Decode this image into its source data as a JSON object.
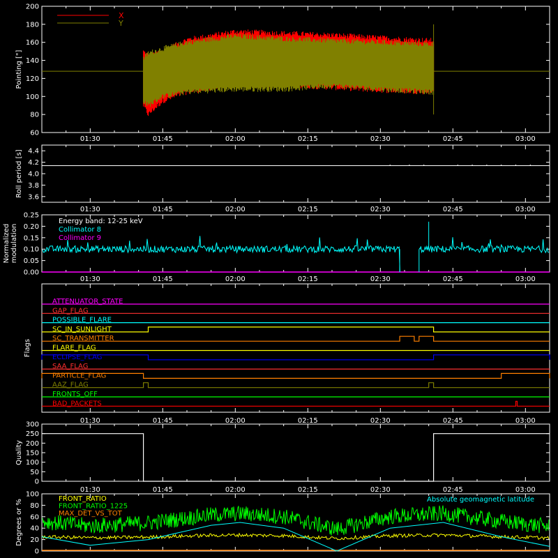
{
  "colors": {
    "background": "#000000",
    "axes": "#ffffff",
    "x_series": "#ff0000",
    "y_series": "#808000",
    "roll": "#ffffff",
    "collimator8": "#00ffff",
    "collimator9": "#ff00ff",
    "quality": "#ffffff",
    "front_ratio": "#ffff00",
    "front_ratio_1225": "#00ff00",
    "max_det_vs_tot": "#ff8000",
    "geomag_lat": "#00ffff"
  },
  "time_axis": {
    "range": [
      "01:20",
      "03:05"
    ],
    "ticks": [
      "01:30",
      "01:45",
      "02:00",
      "02:15",
      "02:30",
      "02:45",
      "03:00"
    ]
  },
  "chart_data": [
    {
      "type": "line",
      "ylabel": "Pointing [\"]",
      "ylim": [
        60,
        200
      ],
      "yticks": [
        60,
        80,
        100,
        120,
        140,
        160,
        180,
        200
      ],
      "legend": [
        {
          "name": "X",
          "color": "#ff0000"
        },
        {
          "name": "Y",
          "color": "#808000"
        }
      ],
      "constant_level": 128,
      "data_window": [
        "01:41",
        "02:41"
      ],
      "series": [
        {
          "name": "X",
          "envelope_time": [
            "01:41",
            "01:42",
            "01:45",
            "01:50",
            "02:00",
            "02:10",
            "02:20",
            "02:30",
            "02:40"
          ],
          "upper": [
            150,
            145,
            150,
            163,
            172,
            170,
            168,
            165,
            162
          ],
          "lower": [
            90,
            80,
            95,
            105,
            113,
            113,
            110,
            107,
            105
          ]
        },
        {
          "name": "Y",
          "envelope_time": [
            "01:41",
            "01:42",
            "01:45",
            "01:50",
            "02:00",
            "02:10",
            "02:20",
            "02:30",
            "02:40"
          ],
          "upper": [
            142,
            148,
            153,
            160,
            167,
            164,
            162,
            160,
            158
          ],
          "lower": [
            95,
            90,
            100,
            105,
            108,
            108,
            112,
            108,
            105
          ]
        }
      ]
    },
    {
      "type": "line",
      "ylabel": "Roll period [s]",
      "ylim": [
        3.5,
        4.5
      ],
      "yticks": [
        3.6,
        3.8,
        4.0,
        4.2,
        4.4
      ],
      "series": [
        {
          "name": "",
          "x": [
            "01:20",
            "03:05"
          ],
          "y": [
            4.14,
            4.14
          ]
        }
      ]
    },
    {
      "type": "line",
      "ylabel": "Normalized modulation",
      "ylim": [
        0.0,
        0.25
      ],
      "yticks": [
        0.0,
        0.05,
        0.1,
        0.15,
        0.2,
        0.25
      ],
      "annotation": "Energy band: 12-25 keV",
      "legend": [
        {
          "name": "Collimator 8",
          "color": "#00ffff"
        },
        {
          "name": "Collimator 9",
          "color": "#ff00ff"
        }
      ],
      "series": [
        {
          "name": "Collimator 8",
          "mean": 0.1,
          "gap": [
            "02:34",
            "02:38"
          ]
        },
        {
          "name": "Collimator 9",
          "x": [
            "01:20",
            "03:05"
          ],
          "y": [
            0.0,
            0.0
          ]
        }
      ]
    },
    {
      "type": "line",
      "ylabel": "Flags",
      "flags": [
        {
          "name": "ATTENUATOR_STATE",
          "color": "#ff00ff",
          "high": []
        },
        {
          "name": "GAP_FLAG",
          "color": "#ff3030",
          "high": []
        },
        {
          "name": "POSSIBLE_FLARE",
          "color": "#00ffff",
          "high": []
        },
        {
          "name": "SC_IN_SUNLIGHT",
          "color": "#ffff00",
          "high": [
            [
              "01:42",
              "02:41"
            ]
          ]
        },
        {
          "name": "SC_TRANSMITTER",
          "color": "#ff8000",
          "high": [
            [
              "02:34",
              "02:37"
            ],
            [
              "02:38",
              "02:41"
            ]
          ]
        },
        {
          "name": "FLARE_FLAG",
          "color": "#ffff00",
          "high": []
        },
        {
          "name": "ECLIPSE_FLAG",
          "color": "#0000ff",
          "high": [
            [
              "01:20",
              "01:42"
            ],
            [
              "02:41",
              "03:05"
            ]
          ]
        },
        {
          "name": "SAA_FLAG",
          "color": "#ff3030",
          "high": []
        },
        {
          "name": "PARTICLE_FLAG",
          "color": "#ff8000",
          "high": [
            [
              "01:20",
              "01:41"
            ],
            [
              "02:55",
              "03:05"
            ]
          ]
        },
        {
          "name": "AAZ_FLAG",
          "color": "#808000",
          "high": [
            [
              "01:41",
              "01:42"
            ],
            [
              "02:40",
              "02:41"
            ]
          ]
        },
        {
          "name": "FRONTS_OFF",
          "color": "#00ff00",
          "high": []
        },
        {
          "name": "BAD_PACKETS",
          "color": "#ff0000",
          "high": [
            [
              "02:58",
              "02:58"
            ]
          ]
        }
      ]
    },
    {
      "type": "line",
      "ylabel": "Quality",
      "ylim": [
        0,
        300
      ],
      "yticks": [
        0,
        50,
        100,
        150,
        200,
        250,
        300
      ],
      "series": [
        {
          "name": "",
          "x": [
            "01:20",
            "01:41",
            "01:41",
            "02:41",
            "02:41",
            "03:05"
          ],
          "y": [
            250,
            250,
            0,
            0,
            250,
            250
          ]
        }
      ]
    },
    {
      "type": "line",
      "ylabel": "Degrees or %",
      "ylim": [
        0,
        100
      ],
      "yticks": [
        0,
        20,
        40,
        60,
        80,
        100
      ],
      "legend": [
        {
          "name": "FRONT_RATIO",
          "color": "#ffff00"
        },
        {
          "name": "FRONT_RATIO_1225",
          "color": "#00ff00"
        },
        {
          "name": "MAX_DET_VS_TOT",
          "color": "#ff8000"
        },
        {
          "name": "Absolute geomagnetic latitude",
          "color": "#00ffff"
        }
      ],
      "series": [
        {
          "name": "FRONT_RATIO",
          "mean": 25
        },
        {
          "name": "FRONT_RATIO_1225",
          "mean": 52
        },
        {
          "name": "MAX_DET_VS_TOT",
          "x": [
            "01:20",
            "03:05"
          ],
          "y": [
            0,
            0
          ]
        },
        {
          "name": "Absolute geomagnetic latitude",
          "x": [
            "01:20",
            "01:30",
            "01:42",
            "01:55",
            "02:01",
            "02:10",
            "02:21",
            "02:32",
            "02:43",
            "02:55",
            "03:05"
          ],
          "y": [
            25,
            10,
            20,
            45,
            50,
            40,
            0,
            40,
            50,
            25,
            8
          ]
        }
      ]
    }
  ]
}
